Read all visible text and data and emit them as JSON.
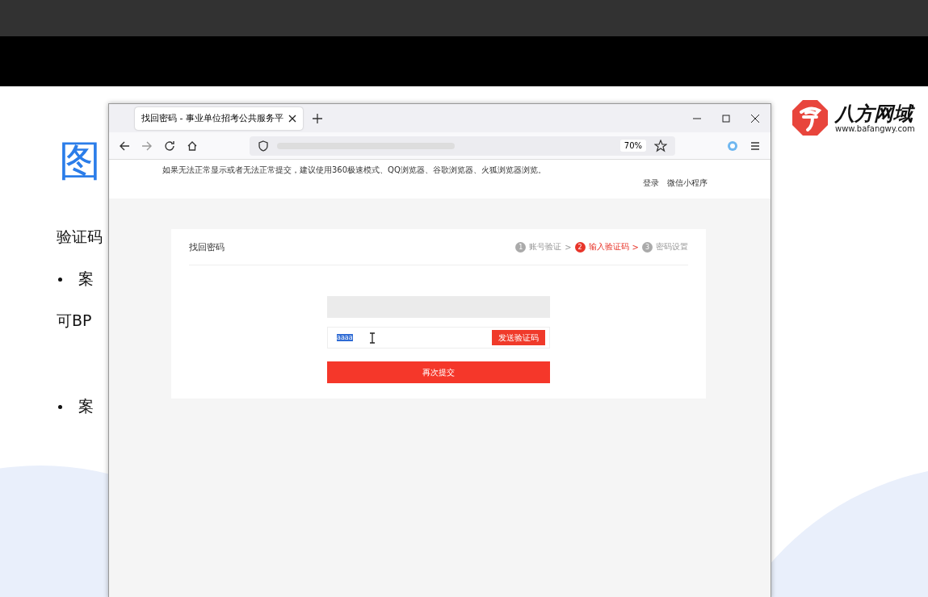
{
  "slide": {
    "title": "图",
    "lines": [
      {
        "kind": "text",
        "text": "验证码"
      },
      {
        "kind": "bullet",
        "text": "案"
      },
      {
        "kind": "text",
        "text": "可BP"
      },
      {
        "kind": "bullet",
        "text": "案"
      }
    ],
    "logo": {
      "name": "八方网域",
      "url": "www.bafangwy.com"
    }
  },
  "browser": {
    "tab": {
      "title": "找回密码 - 事业单位招考公共服务平",
      "selected": true
    },
    "zoom": "70%"
  },
  "page": {
    "notice": "如果无法正常显示或者无法正常提交，建议使用360极速模式、QQ浏览器、谷歌浏览器、火狐浏览器浏览。",
    "links": [
      "登录",
      "微信小程序"
    ],
    "card": {
      "title": "找回密码",
      "steps": [
        {
          "number": "1",
          "label": "账号验证",
          "separator": ">",
          "selected": false
        },
        {
          "number": "2",
          "label": "输入验证码",
          "separator": ">",
          "selected": true
        },
        {
          "number": "3",
          "label": "密码设置",
          "selected": false
        }
      ],
      "code_field": {
        "value": "aaaa"
      },
      "send_button": "发送验证码",
      "submit_button": "再次提交"
    }
  }
}
